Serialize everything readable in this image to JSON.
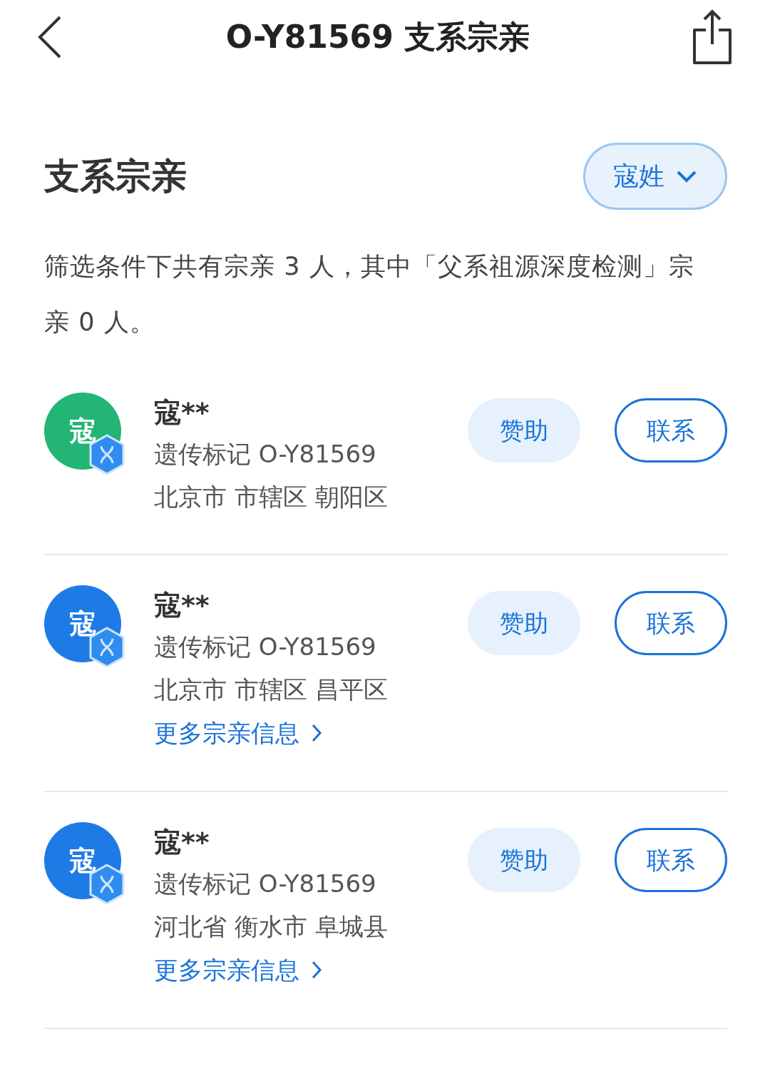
{
  "header": {
    "title": "O-Y81569 支系宗亲"
  },
  "section": {
    "title": "支系宗亲",
    "filter": "寇姓"
  },
  "summary": "筛选条件下共有宗亲 3 人，其中「父系祖源深度检测」宗亲 0 人。",
  "relatives": [
    {
      "avatar": "寇",
      "color": "#22b573",
      "name": "寇**",
      "marker": "遗传标记 O-Y81569",
      "location": "北京市 市辖区 朝阳区",
      "sponsor": "赞助",
      "contact": "联系"
    },
    {
      "avatar": "寇",
      "color": "#1e7be6",
      "name": "寇**",
      "marker": "遗传标记 O-Y81569",
      "location": "北京市 市辖区 昌平区",
      "more": "更多宗亲信息",
      "sponsor": "赞助",
      "contact": "联系"
    },
    {
      "avatar": "寇",
      "color": "#1e7be6",
      "name": "寇**",
      "marker": "遗传标记 O-Y81569",
      "location": "河北省 衡水市 阜城县",
      "more": "更多宗亲信息",
      "sponsor": "赞助",
      "contact": "联系"
    }
  ]
}
